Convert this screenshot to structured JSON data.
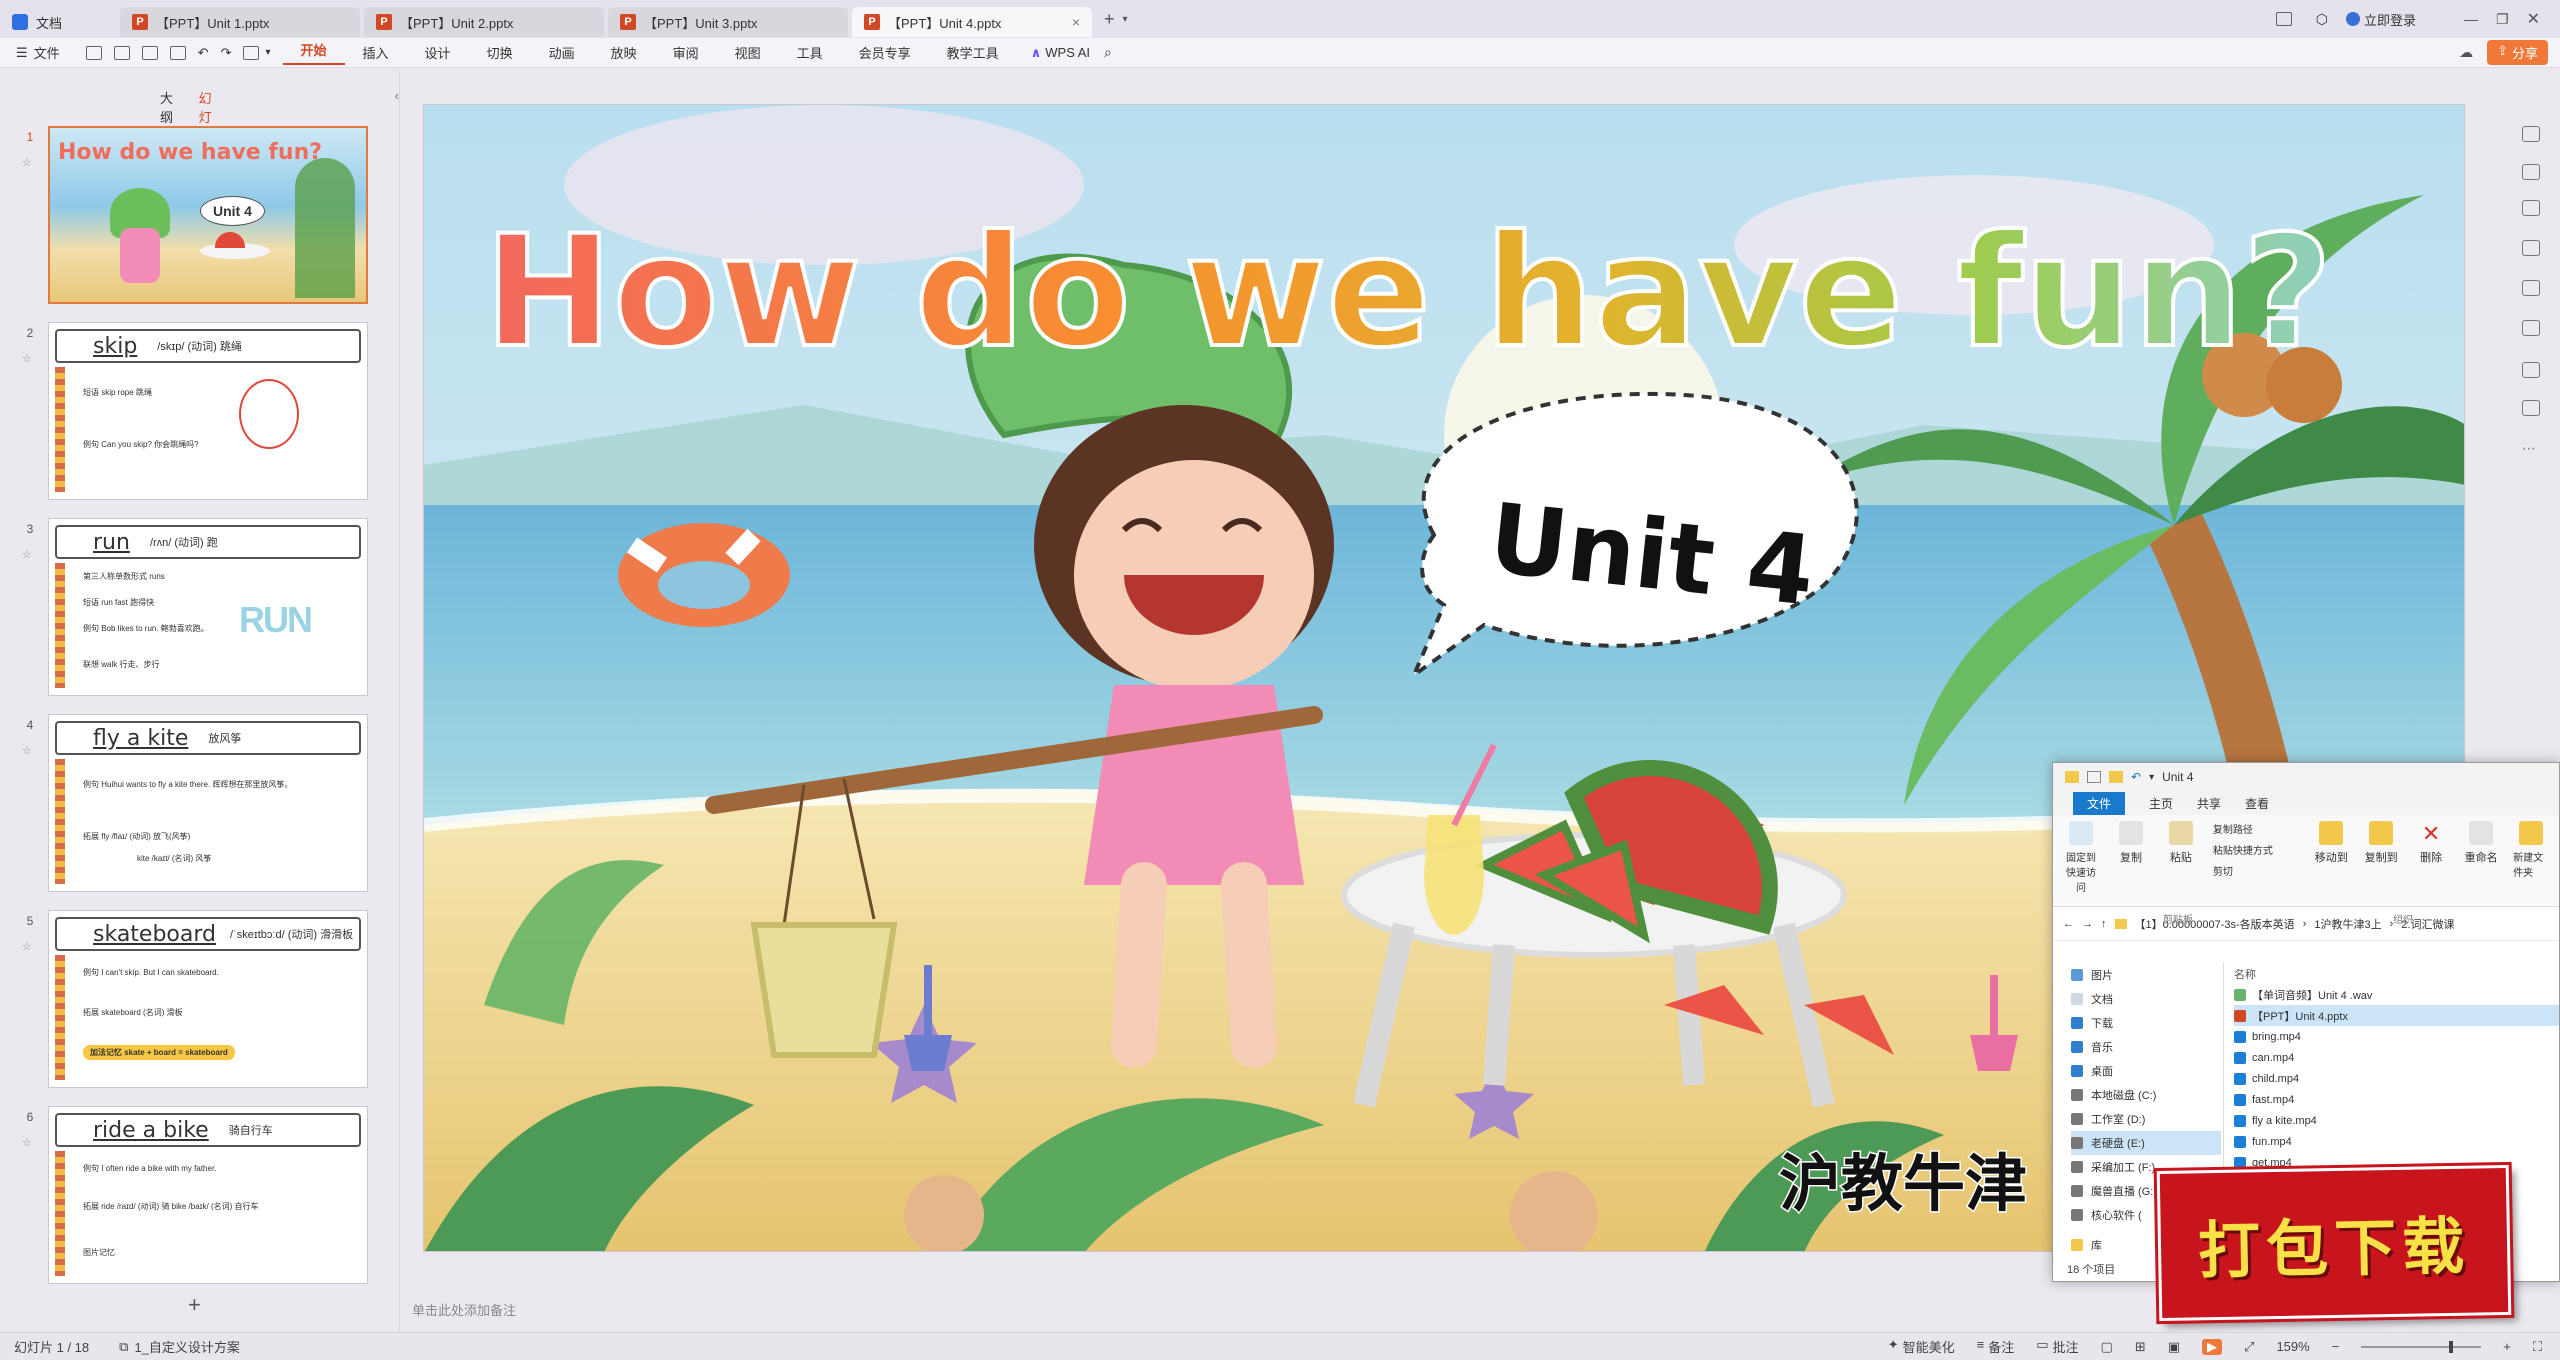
{
  "tabs": [
    {
      "label": "文档",
      "type": "doc"
    },
    {
      "label": "【PPT】Unit 1.pptx",
      "type": "ppt"
    },
    {
      "label": "【PPT】Unit 2.pptx",
      "type": "ppt"
    },
    {
      "label": "【PPT】Unit 3.pptx",
      "type": "ppt"
    },
    {
      "label": "【PPT】Unit 4.pptx",
      "type": "ppt",
      "active": true
    }
  ],
  "titlebar": {
    "login": "立即登录",
    "share": "分享"
  },
  "menu": {
    "file": "文件",
    "items": [
      "开始",
      "插入",
      "设计",
      "切换",
      "动画",
      "放映",
      "审阅",
      "视图",
      "工具",
      "会员专享",
      "教学工具"
    ],
    "wps_ai": "WPS AI"
  },
  "leftpanel": {
    "tab_outline": "大纲",
    "tab_slides": "幻灯片",
    "thumbs": [
      {
        "num": "1",
        "title": "How do we have fun?",
        "unit": "Unit 4"
      },
      {
        "num": "2",
        "word": "skip",
        "ipa": "/skɪp/  (动词) 跳绳",
        "lines": [
          "短语  skip rope 跳绳",
          "例句  Can you skip? 你会跳绳吗?"
        ]
      },
      {
        "num": "3",
        "word": "run",
        "ipa": "/rʌn/  (动词) 跑",
        "lines": [
          "第三人称单数形式  runs",
          "短语  run fast 跑得快",
          "例句  Bob likes to run. 鲍勃喜欢跑。",
          "联想  walk 行走、步行"
        ]
      },
      {
        "num": "4",
        "word": "fly a kite",
        "ipa": "放风筝",
        "lines": [
          "例句  Huihui wants to fly a kite there. 辉辉想在那里放风筝。",
          "拓展  fly /flaɪ/ (动词) 放飞(风筝)",
          "kite /kaɪt/ (名词) 风筝"
        ]
      },
      {
        "num": "5",
        "word": "skateboard",
        "ipa": "/ˈskeɪtbɔːd/  (动词) 滑滑板",
        "lines": [
          "例句  I can't skip. But I can skateboard.",
          "拓展  skateboard (名词) 滑板",
          "加法记忆  skate + board = skateboard"
        ]
      },
      {
        "num": "6",
        "word": "ride a bike",
        "ipa": "骑自行车",
        "lines": [
          "例句  I often ride a bike with my father.",
          "拓展  ride /raɪd/ (动词) 骑  bike /baɪk/ (名词) 自行车",
          "图片记忆"
        ]
      }
    ]
  },
  "slide": {
    "title": "How do we have fun?",
    "unit": "Unit 4",
    "publisher": "沪教牛津"
  },
  "notes_placeholder": "单击此处添加备注",
  "status": {
    "slide_counter": "幻灯片 1 / 18",
    "theme": "1_自定义设计方案",
    "smart_beautify": "智能美化",
    "notes": "备注",
    "comments": "批注",
    "zoom": "159%"
  },
  "explorer": {
    "title": "Unit 4",
    "ribbon_tabs": [
      "文件",
      "主页",
      "共享",
      "查看"
    ],
    "ribbon_buttons": [
      "固定到快速访问",
      "复制",
      "粘贴",
      "复制路径",
      "粘贴快捷方式",
      "剪切",
      "移动到",
      "复制到",
      "删除",
      "重命名",
      "新建文件夹"
    ],
    "group_clipboard": "剪贴板",
    "group_organize": "组织",
    "address": [
      "【1】0.00000007-3s-各版本英语",
      "1沪教牛津3上",
      "2.词汇微课"
    ],
    "nav": [
      "图片",
      "文档",
      "下载",
      "音乐",
      "桌面",
      "本地磁盘 (C:)",
      "工作室 (D:)",
      "老硬盘 (E:)",
      "采编加工 (F:)",
      "魔兽直播 (G:)",
      "核心软件 (",
      "库"
    ],
    "column_name": "名称",
    "files": [
      "【单词音频】Unit 4 .wav",
      "【PPT】Unit 4.pptx",
      "bring.mp4",
      "can.mp4",
      "child.mp4",
      "fast.mp4",
      "fly a kite.mp4",
      "fun.mp4",
      "get.mp4"
    ],
    "item_count": "18 个项目"
  },
  "download_banner": "打包下载"
}
